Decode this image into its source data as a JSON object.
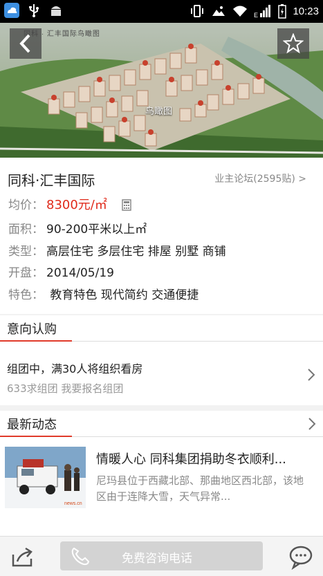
{
  "status_bar": {
    "time": "10:23",
    "left_icons": [
      "cloud-icon",
      "usb-icon",
      "android-icon"
    ],
    "right_icons": [
      "vibrate-icon",
      "photo-icon",
      "wifi-icon",
      "signal-icon",
      "battery-icon"
    ],
    "network_label": "E"
  },
  "hero": {
    "top_caption": "同科 · 汇丰国际鸟瞰图",
    "image_label": "鸟瞰图"
  },
  "property": {
    "name": "同科·汇丰国际",
    "forum_link": "业主论坛(2595贴) >",
    "price_label": "均价：",
    "price_value": "8300元/㎡",
    "area_label": "面积：",
    "area_value": "90-200平米以上㎡",
    "type_label": "类型：",
    "type_value": "高层住宅 多层住宅 排屋 别墅 商铺",
    "open_label": "开盘：",
    "open_value": "2014/05/19",
    "feature_label": "特色：",
    "feature_value": " 教育特色 现代简约 交通便捷"
  },
  "intent_section": {
    "title": "意向认购",
    "line1": "组团中，满30人将组织看房",
    "line2": "633求组团 我要报名组团"
  },
  "news_section": {
    "title": "最新动态",
    "item_title": "情暖人心 同科集团捐助冬衣顺利...",
    "item_body": "尼玛县位于西藏北部、那曲地区西北部，该地区由于连降大雪，天气异常..."
  },
  "bottom_bar": {
    "call_label": "免费咨询电话"
  },
  "colors": {
    "accent": "#e03a2a",
    "price": "#e02a1a"
  }
}
